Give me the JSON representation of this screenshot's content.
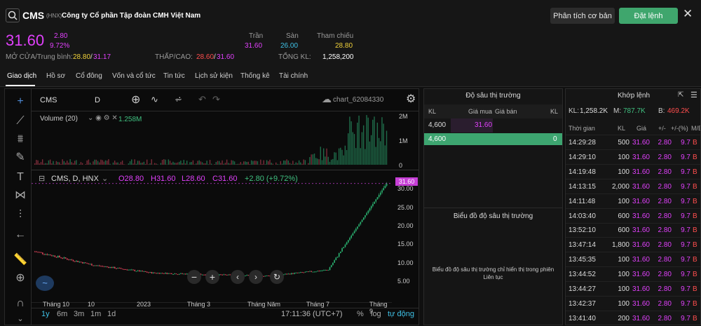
{
  "header": {
    "ticker": "CMS",
    "exchange": "(HNX)",
    "company": "Công ty Cổ phần Tập đoàn CMH Việt Nam",
    "analysis_btn": "Phân tích cơ bản",
    "order_btn": "Đặt lệnh"
  },
  "quote": {
    "price": "31.60",
    "change": "2.80",
    "change_pct": "9.72%",
    "ceiling_label": "Trần",
    "ceiling": "31.60",
    "floor_label": "Sàn",
    "floor": "26.00",
    "ref_label": "Tham chiếu",
    "ref": "28.80",
    "open_avg_label": "MỞ CỬA/Trung bình:",
    "open": "28.80",
    "avg": "31.17",
    "low_high_label": "THẤP/CAO:",
    "low": "28.60",
    "high": "31.60",
    "vol_label": "TỔNG KL:",
    "vol": "1,258,200"
  },
  "tabs": [
    "Giao dịch",
    "Hồ sơ",
    "Cổ đông",
    "Vốn và cổ tức",
    "Tin tức",
    "Lịch sử kiện",
    "Thống kê",
    "Tài chính"
  ],
  "chart": {
    "symbol": "CMS",
    "interval": "D",
    "chart_name": "chart_62084330",
    "volume_label": "Volume (20)",
    "volume_value": "1.258M",
    "vol_ticks": [
      "2M",
      "1M",
      "0"
    ],
    "legend_title": "CMS, D, HNX",
    "o": "O28.80",
    "h": "H31.60",
    "l": "L28.60",
    "c": "C31.60",
    "chg": "+2.80 (+9.72%)",
    "last": "31.60",
    "price_ticks": [
      "30.00",
      "25.00",
      "20.00",
      "15.00",
      "10.00",
      "5.00"
    ],
    "x_ticks": [
      "Tháng 10",
      "10",
      "2023",
      "Tháng 3",
      "Tháng Năm",
      "Tháng 7",
      "Tháng 9"
    ],
    "ranges": [
      "1y",
      "6m",
      "3m",
      "1m",
      "1d"
    ],
    "time": "17:11:36 (UTC+7)",
    "pct": "%",
    "log": "log",
    "auto": "tự động"
  },
  "chart_data": {
    "type": "candlestick",
    "title": "CMS, D, HNX",
    "ylim": [
      2.5,
      32.5
    ],
    "x_ticks": [
      "Tháng 10",
      "10",
      "2023",
      "Tháng 3",
      "Tháng Năm",
      "Tháng 7",
      "Tháng 9"
    ],
    "close_trend": [
      {
        "x": "Tháng 10",
        "y": 13.2
      },
      {
        "x": "10",
        "y": 9.5
      },
      {
        "x": "2023",
        "y": 7.4
      },
      {
        "x": "Tháng 3",
        "y": 6.9
      },
      {
        "x": "Tháng Năm",
        "y": 6.6
      },
      {
        "x": "Tháng 7",
        "y": 8.2
      },
      {
        "x": "Tháng 9",
        "y": 31.6
      }
    ],
    "last": 31.6
  },
  "depth": {
    "title": "Độ sâu thị trường",
    "cols": [
      "KL",
      "Giá mua",
      "Giá bán",
      "KL"
    ],
    "row_vol": "4,600",
    "row_price": "31.60",
    "total_left": "4,600",
    "total_right": "0",
    "chart_title": "Biểu đồ độ sâu thị trường",
    "chart_note": "Biểu đồ độ sâu thị trường chỉ hiển thị trong phiên Liên tục"
  },
  "match": {
    "title": "Khớp lệnh",
    "kl_label": "KL:",
    "kl": "1,258.2K",
    "m_label": "M:",
    "m": "787.7K",
    "b_label": "B:",
    "b": "469.2K",
    "cols": [
      "Thời gian",
      "KL",
      "Giá",
      "+/-",
      "+/-(%)",
      "M/B"
    ],
    "rows": [
      [
        "14:29:28",
        "500",
        "31.60",
        "2.80",
        "9.7",
        "B"
      ],
      [
        "14:29:10",
        "100",
        "31.60",
        "2.80",
        "9.7",
        "B"
      ],
      [
        "14:19:48",
        "100",
        "31.60",
        "2.80",
        "9.7",
        "B"
      ],
      [
        "14:13:15",
        "2,000",
        "31.60",
        "2.80",
        "9.7",
        "B"
      ],
      [
        "14:11:48",
        "100",
        "31.60",
        "2.80",
        "9.7",
        "B"
      ],
      [
        "14:03:40",
        "600",
        "31.60",
        "2.80",
        "9.7",
        "B"
      ],
      [
        "13:52:10",
        "600",
        "31.60",
        "2.80",
        "9.7",
        "B"
      ],
      [
        "13:47:14",
        "1,800",
        "31.60",
        "2.80",
        "9.7",
        "B"
      ],
      [
        "13:45:35",
        "100",
        "31.60",
        "2.80",
        "9.7",
        "B"
      ],
      [
        "13:44:52",
        "100",
        "31.60",
        "2.80",
        "9.7",
        "B"
      ],
      [
        "13:44:27",
        "100",
        "31.60",
        "2.80",
        "9.7",
        "B"
      ],
      [
        "13:42:37",
        "100",
        "31.60",
        "2.80",
        "9.7",
        "B"
      ],
      [
        "13:41:40",
        "200",
        "31.60",
        "2.80",
        "9.7",
        "B"
      ]
    ]
  }
}
